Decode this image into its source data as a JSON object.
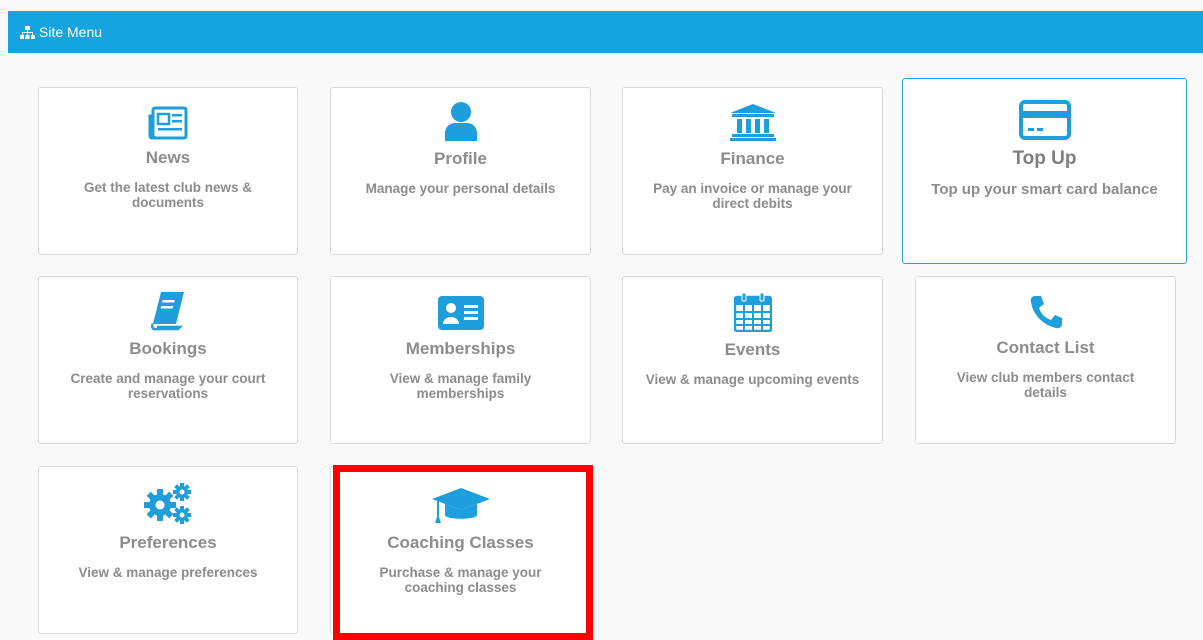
{
  "header": {
    "title": "Site Menu",
    "icon": "sitemap-icon"
  },
  "tiles": [
    {
      "id": "news",
      "icon": "newspaper-icon",
      "title": "News",
      "desc": "Get the latest club news & documents"
    },
    {
      "id": "profile",
      "icon": "user-icon",
      "title": "Profile",
      "desc": "Manage your personal details"
    },
    {
      "id": "finance",
      "icon": "bank-icon",
      "title": "Finance",
      "desc": "Pay an invoice or manage your direct debits"
    },
    {
      "id": "topup",
      "icon": "credit-card-icon",
      "title": "Top Up",
      "desc": "Top up your smart card balance"
    },
    {
      "id": "bookings",
      "icon": "book-icon",
      "title": "Bookings",
      "desc": "Create and manage your court reservations"
    },
    {
      "id": "memberships",
      "icon": "id-card-icon",
      "title": "Memberships",
      "desc": "View & manage family memberships"
    },
    {
      "id": "events",
      "icon": "calendar-icon",
      "title": "Events",
      "desc": "View & manage upcoming events"
    },
    {
      "id": "contact",
      "icon": "phone-icon",
      "title": "Contact List",
      "desc": "View club members contact details"
    },
    {
      "id": "preferences",
      "icon": "gears-icon",
      "title": "Preferences",
      "desc": "View & manage preferences"
    },
    {
      "id": "coaching",
      "icon": "graduation-cap-icon",
      "title": "Coaching Classes",
      "desc": "Purchase & manage your coaching classes"
    }
  ],
  "colors": {
    "accent": "#15a4e0",
    "icon": "#1e9fdb",
    "text": "#8c8c8c",
    "highlight": "#ff0000"
  }
}
